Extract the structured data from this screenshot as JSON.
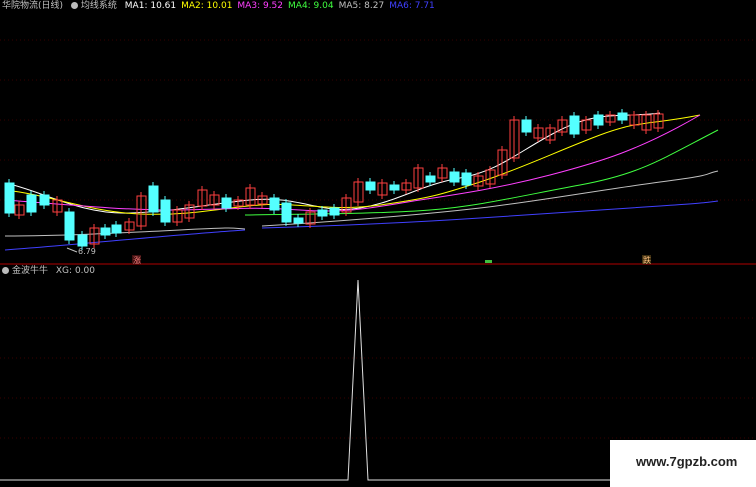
{
  "main_panel": {
    "stock_name": "华院物流(日线)",
    "indicator_name": "均线系统",
    "ma": [
      {
        "label": "MA1:",
        "value": "10.61",
        "color": "#ffffff"
      },
      {
        "label": "MA2:",
        "value": "10.01",
        "color": "#ffff00"
      },
      {
        "label": "MA3:",
        "value": "9.52",
        "color": "#ff40ff"
      },
      {
        "label": "MA4:",
        "value": "9.04",
        "color": "#40ff40"
      },
      {
        "label": "MA5:",
        "value": "8.27",
        "color": "#c0c0c0"
      },
      {
        "label": "MA6:",
        "value": "7.71",
        "color": "#4040ff"
      }
    ],
    "low_marker": "6.79",
    "signal_marks": [
      "涨",
      "跌"
    ]
  },
  "sub_panel": {
    "indicator_name": "金波牛牛",
    "xg_label": "XG:",
    "xg_value": "0.00"
  },
  "watermark": "www.7gpzb.com",
  "colors": {
    "up": "#ff4040",
    "down": "#54ffff",
    "grid": "#8b0000",
    "signal": "#e0e0e0"
  }
}
